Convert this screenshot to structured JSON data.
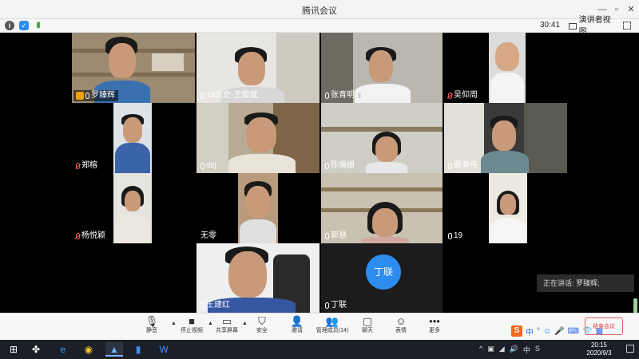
{
  "window": {
    "title": "腾讯会议"
  },
  "infobar": {
    "timer": "30:41",
    "speaker_view_label": "演讲者视图"
  },
  "participants": [
    {
      "name": "罗臻辉",
      "host": true
    },
    {
      "name": "19历史-王俊斌"
    },
    {
      "name": "张育明"
    },
    {
      "name": "吴仰周"
    },
    {
      "name": "郑榕"
    },
    {
      "name": "dzj"
    },
    {
      "name": "陈儒栅"
    },
    {
      "name": "覃寿伟"
    },
    {
      "name": "杨悦颖"
    },
    {
      "name": "无零"
    },
    {
      "name": "郭慧"
    },
    {
      "name": "19"
    },
    {
      "name": "王建红"
    },
    {
      "name": "丁联",
      "avatar_text": "丁联"
    }
  ],
  "speaking": {
    "text": "正在讲话: 罗臻辉;"
  },
  "toolbar": {
    "buttons": [
      {
        "label": "静音",
        "icon": "mic-icon"
      },
      {
        "label": "停止视频",
        "icon": "camera-icon"
      },
      {
        "label": "共享屏幕",
        "icon": "share-screen-icon"
      },
      {
        "label": "安全",
        "icon": "shield-icon"
      },
      {
        "label": "邀请",
        "icon": "invite-icon"
      },
      {
        "label": "管理成员(14)",
        "icon": "members-icon"
      },
      {
        "label": "聊天",
        "icon": "chat-icon"
      },
      {
        "label": "表情",
        "icon": "emoji-icon"
      },
      {
        "label": "更多",
        "icon": "more-icon"
      }
    ],
    "end_label": "结束会议",
    "ime_lang": "中"
  },
  "taskbar": {
    "ime_lang": "中",
    "time": "20:15",
    "date": "2020/9/3"
  },
  "colors": {
    "accent": "#2d8cf0",
    "end": "#e04040",
    "host": "#f0a000"
  }
}
